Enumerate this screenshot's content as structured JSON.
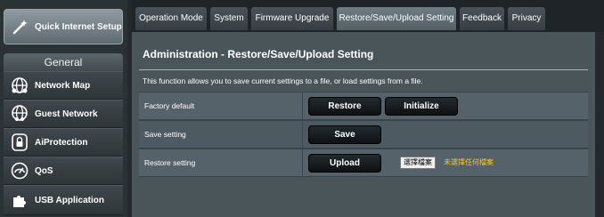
{
  "sidebar": {
    "quick_setup": {
      "label": "Quick Internet Setup",
      "icon": "wand-icon"
    },
    "section_header": "General",
    "items": [
      {
        "label": "Network Map",
        "icon": "globe-icon"
      },
      {
        "label": "Guest Network",
        "icon": "guest-globe-icon"
      },
      {
        "label": "AiProtection",
        "icon": "lock-shield-icon"
      },
      {
        "label": "QoS",
        "icon": "gauge-icon"
      },
      {
        "label": "USB Application",
        "icon": "puzzle-icon"
      }
    ]
  },
  "tabs": [
    {
      "label": "Operation Mode",
      "active": false
    },
    {
      "label": "System",
      "active": false
    },
    {
      "label": "Firmware Upgrade",
      "active": false
    },
    {
      "label": "Restore/Save/Upload Setting",
      "active": true
    },
    {
      "label": "Feedback",
      "active": false
    },
    {
      "label": "Privacy",
      "active": false
    }
  ],
  "main": {
    "title": "Administration - Restore/Save/Upload Setting",
    "description": "This function allows you to save current settings to a file, or load settings from a file.",
    "rows": {
      "factory": {
        "label": "Factory default",
        "restore_button": "Restore",
        "initialize_button": "Initialize"
      },
      "save": {
        "label": "Save setting",
        "save_button": "Save"
      },
      "restore": {
        "label": "Restore setting",
        "upload_button": "Upload",
        "file_button": "選擇檔案",
        "file_status": "未選擇任何檔案"
      }
    }
  },
  "colors": {
    "background": "#23292d",
    "panel": "#4a555a",
    "file_status": "#ffcc00"
  }
}
